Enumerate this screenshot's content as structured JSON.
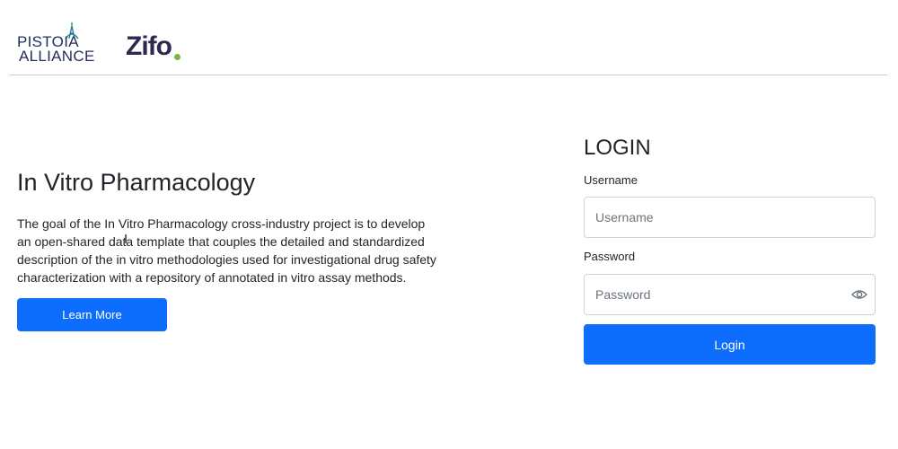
{
  "header": {
    "pistoia_logo": {
      "line1": "PISTOIA",
      "line2": "ALLIANCE",
      "color": "#23305d"
    },
    "zifo_logo": {
      "text": "Zifo",
      "color": "#2d2a4f",
      "dot_color": "#7ab540"
    }
  },
  "hero": {
    "title": "In Vitro Pharmacology",
    "description": "The goal of the In Vitro Pharmacology cross-industry project is to develop an open-shared data template that couples the detailed and standardized description of the in vitro methodologies used for investigational drug safety characterization with a repository of annotated in vitro assay methods.",
    "learn_more_label": "Learn More",
    "cursor_glyph": "I"
  },
  "login": {
    "title": "LOGIN",
    "username_label": "Username",
    "username_placeholder": "Username",
    "username_value": "",
    "password_label": "Password",
    "password_placeholder": "Password",
    "password_value": "",
    "password_toggle_icon": "eye-icon",
    "submit_label": "Login"
  },
  "colors": {
    "primary": "#0d6efd",
    "text": "#212529",
    "border": "#ced4da"
  }
}
